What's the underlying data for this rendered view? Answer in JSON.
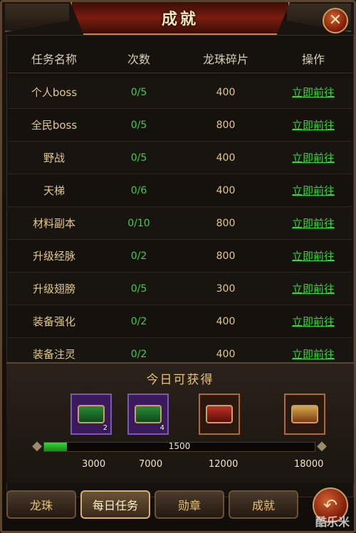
{
  "window": {
    "title": "成就"
  },
  "table": {
    "headers": [
      "任务名称",
      "次数",
      "龙珠碎片",
      "操作"
    ],
    "rows": [
      {
        "name": "个人boss",
        "count": "0/5",
        "reward": "400",
        "action": "立即前往"
      },
      {
        "name": "全民boss",
        "count": "0/5",
        "reward": "800",
        "action": "立即前往"
      },
      {
        "name": "野战",
        "count": "0/5",
        "reward": "400",
        "action": "立即前往"
      },
      {
        "name": "天梯",
        "count": "0/6",
        "reward": "400",
        "action": "立即前往"
      },
      {
        "name": "材料副本",
        "count": "0/10",
        "reward": "800",
        "action": "立即前往"
      },
      {
        "name": "升级经脉",
        "count": "0/2",
        "reward": "800",
        "action": "立即前往"
      },
      {
        "name": "升级翅膀",
        "count": "0/5",
        "reward": "300",
        "action": "立即前往"
      },
      {
        "name": "装备强化",
        "count": "0/2",
        "reward": "400",
        "action": "立即前往"
      },
      {
        "name": "装备注灵",
        "count": "0/2",
        "reward": "400",
        "action": "立即前往"
      }
    ]
  },
  "today": {
    "title": "今日可获得",
    "chests": [
      {
        "icon": "green-chest-icon",
        "count": "2"
      },
      {
        "icon": "green-chest-icon",
        "count": "4"
      },
      {
        "icon": "red-chest-icon",
        "count": ""
      },
      {
        "icon": "gold-chest-icon",
        "count": ""
      }
    ],
    "progress": {
      "value": 1500,
      "max": 18000,
      "label": "1500"
    },
    "milestones": [
      "3000",
      "7000",
      "12000",
      "18000"
    ]
  },
  "tabs": [
    "龙珠",
    "每日任务",
    "勋章",
    "成就"
  ],
  "active_tab": "每日任务",
  "watermark": "酷乐米",
  "colors": {
    "accent": "#e6c27a",
    "action_link": "#2fdc2f",
    "count": "#3fcf3f"
  }
}
